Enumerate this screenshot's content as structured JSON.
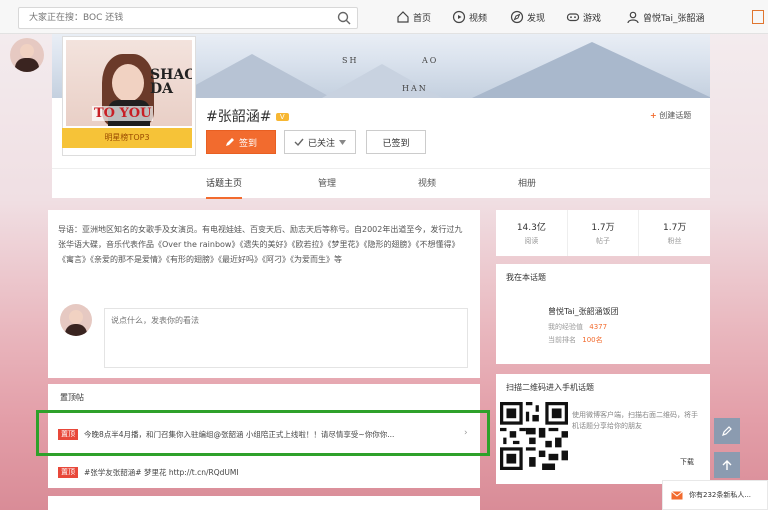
{
  "nav": {
    "search_placeholder": "大家正在搜：BOC 还钱",
    "items": [
      {
        "label": "首页",
        "icon": "home-icon"
      },
      {
        "label": "视频",
        "icon": "video-icon"
      },
      {
        "label": "发现",
        "icon": "discover-icon"
      },
      {
        "label": "游戏",
        "icon": "game-icon"
      },
      {
        "label": "曾悦Tai_张韶涵",
        "icon": "user-icon"
      }
    ]
  },
  "banner": {
    "letters": [
      "SH",
      "AO",
      "HAN"
    ]
  },
  "header": {
    "avatar_text": "TO YOU",
    "avatar_text_small": "SHAO\nDA",
    "rank_label": "明星榜TOP3",
    "title": "#张韶涵#",
    "badge": "V",
    "sign_button": "签到",
    "follow_button": "已关注",
    "signed_button": "已签到",
    "create_topic": "创建话题"
  },
  "tabs": [
    {
      "label": "话题主页",
      "active": true
    },
    {
      "label": "管理",
      "active": false
    },
    {
      "label": "视频",
      "active": false
    },
    {
      "label": "相册",
      "active": false
    }
  ],
  "intro": {
    "text": "导语：亚洲地区知名的女歌手及女演员。有电视娃娃、百变天后、励志天后等称号。自2002年出道至今，发行过九张华语大碟，音乐代表作品《Over the rainbow》《遗失的美好》《欧若拉》《梦里花》《隐形的翅膀》《不想懂得》《寓言》《亲爱的那不是爱情》《有形的翅膀》《最近好吗》《阿刁》《为爱而生》等",
    "comment_placeholder": "说点什么，发表你的看法"
  },
  "feed": {
    "header": "置顶帖",
    "rows": [
      {
        "tag": "置顶",
        "text": "今晚8点半4月播，和门召集你入驻编组@张韶涵 小组陪正式上线啦！！请尽情享受~你你你..."
      },
      {
        "tag": "置顶",
        "text": "#张学友张韶涵# 梦里花 http://t.cn/RQdUMI"
      }
    ]
  },
  "stats": [
    {
      "value": "14.3亿",
      "label": "阅读"
    },
    {
      "value": "1.7万",
      "label": "帖子"
    },
    {
      "value": "1.7万",
      "label": "粉丝"
    }
  ],
  "rank_card": {
    "title": "我在本话题",
    "name": "曾悦Tai_张韶涵饭团",
    "line1_label": "我的经验值",
    "line1_value": "4377",
    "line2_label": "当前排名",
    "line2_value": "100名"
  },
  "qr": {
    "title": "扫描二维码进入手机话题",
    "text": "使用微博客户端，扫描右面二维码，将手机话题分享给你的朋友",
    "download": "下载"
  },
  "notif": {
    "text": "你有232条新私人..."
  },
  "colors": {
    "accent": "#f26b2e",
    "highlight": "#2ea12a",
    "tag": "#e8483a",
    "rank_gold": "#f6c338"
  }
}
